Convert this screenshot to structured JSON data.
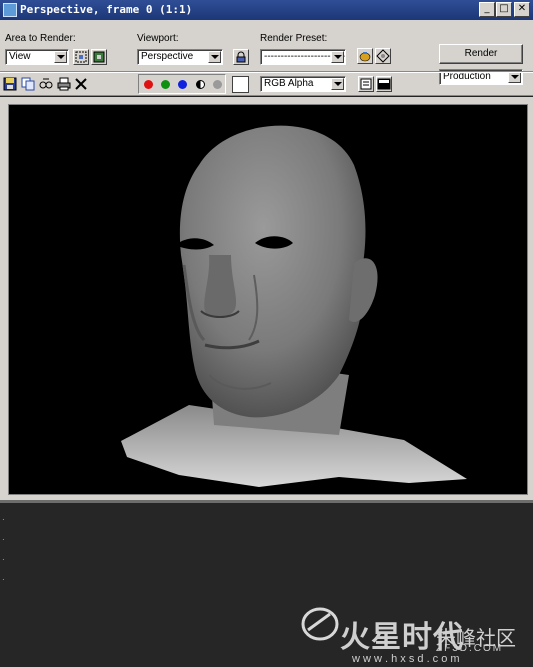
{
  "window": {
    "title": "Perspective, frame 0 (1:1)",
    "minimize_glyph": "_",
    "maximize_glyph": "□",
    "close_glyph": "✕"
  },
  "toolbar": {
    "area_label": "Area to Render:",
    "area_value": "View",
    "viewport_label": "Viewport:",
    "viewport_value": "Perspective",
    "preset_label": "Render Preset:",
    "preset_value": "-----------------------------",
    "render_button": "Render",
    "production_value": "Production",
    "channel_value": "RGB Alpha"
  },
  "channels": {
    "red": "#e01010",
    "green": "#10a010",
    "blue": "#1020e0"
  },
  "watermark": {
    "brand": "火星时代",
    "community": "朱峰社区",
    "site_a": "ZF3D.COM",
    "site_b": "w w w . h x s d . c o m"
  }
}
